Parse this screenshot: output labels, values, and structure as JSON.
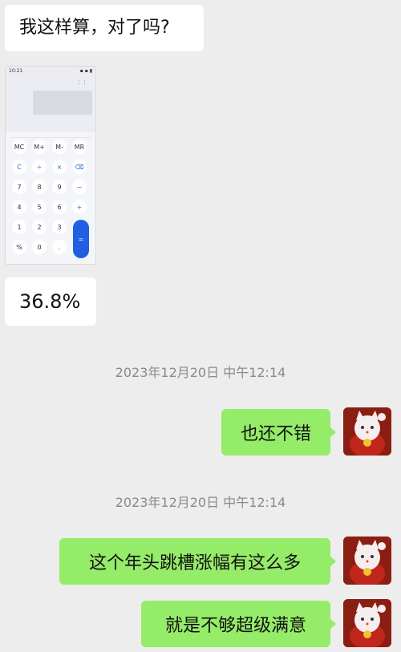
{
  "messages": {
    "m1": "我这样算，对了吗?",
    "m2": "36.8%",
    "ts1": "2023年12月20日 中午12:14",
    "m3": "也还不错",
    "ts2": "2023年12月20日 中午12:14",
    "m4": "这个年头跳槽涨幅有这么多",
    "m5": "就是不够超级满意"
  },
  "calculator": {
    "status_time": "10:21",
    "keys_row1": [
      "MC",
      "M+",
      "M-",
      "MR"
    ],
    "keys_row2": [
      "C",
      "÷",
      "×",
      "⌫"
    ],
    "keys_row3": [
      "7",
      "8",
      "9",
      "−"
    ],
    "keys_row4": [
      "4",
      "5",
      "6",
      "+"
    ],
    "keys_row5": [
      "1",
      "2",
      "3"
    ],
    "keys_row6": [
      "%",
      "0",
      "."
    ],
    "equal": "="
  }
}
